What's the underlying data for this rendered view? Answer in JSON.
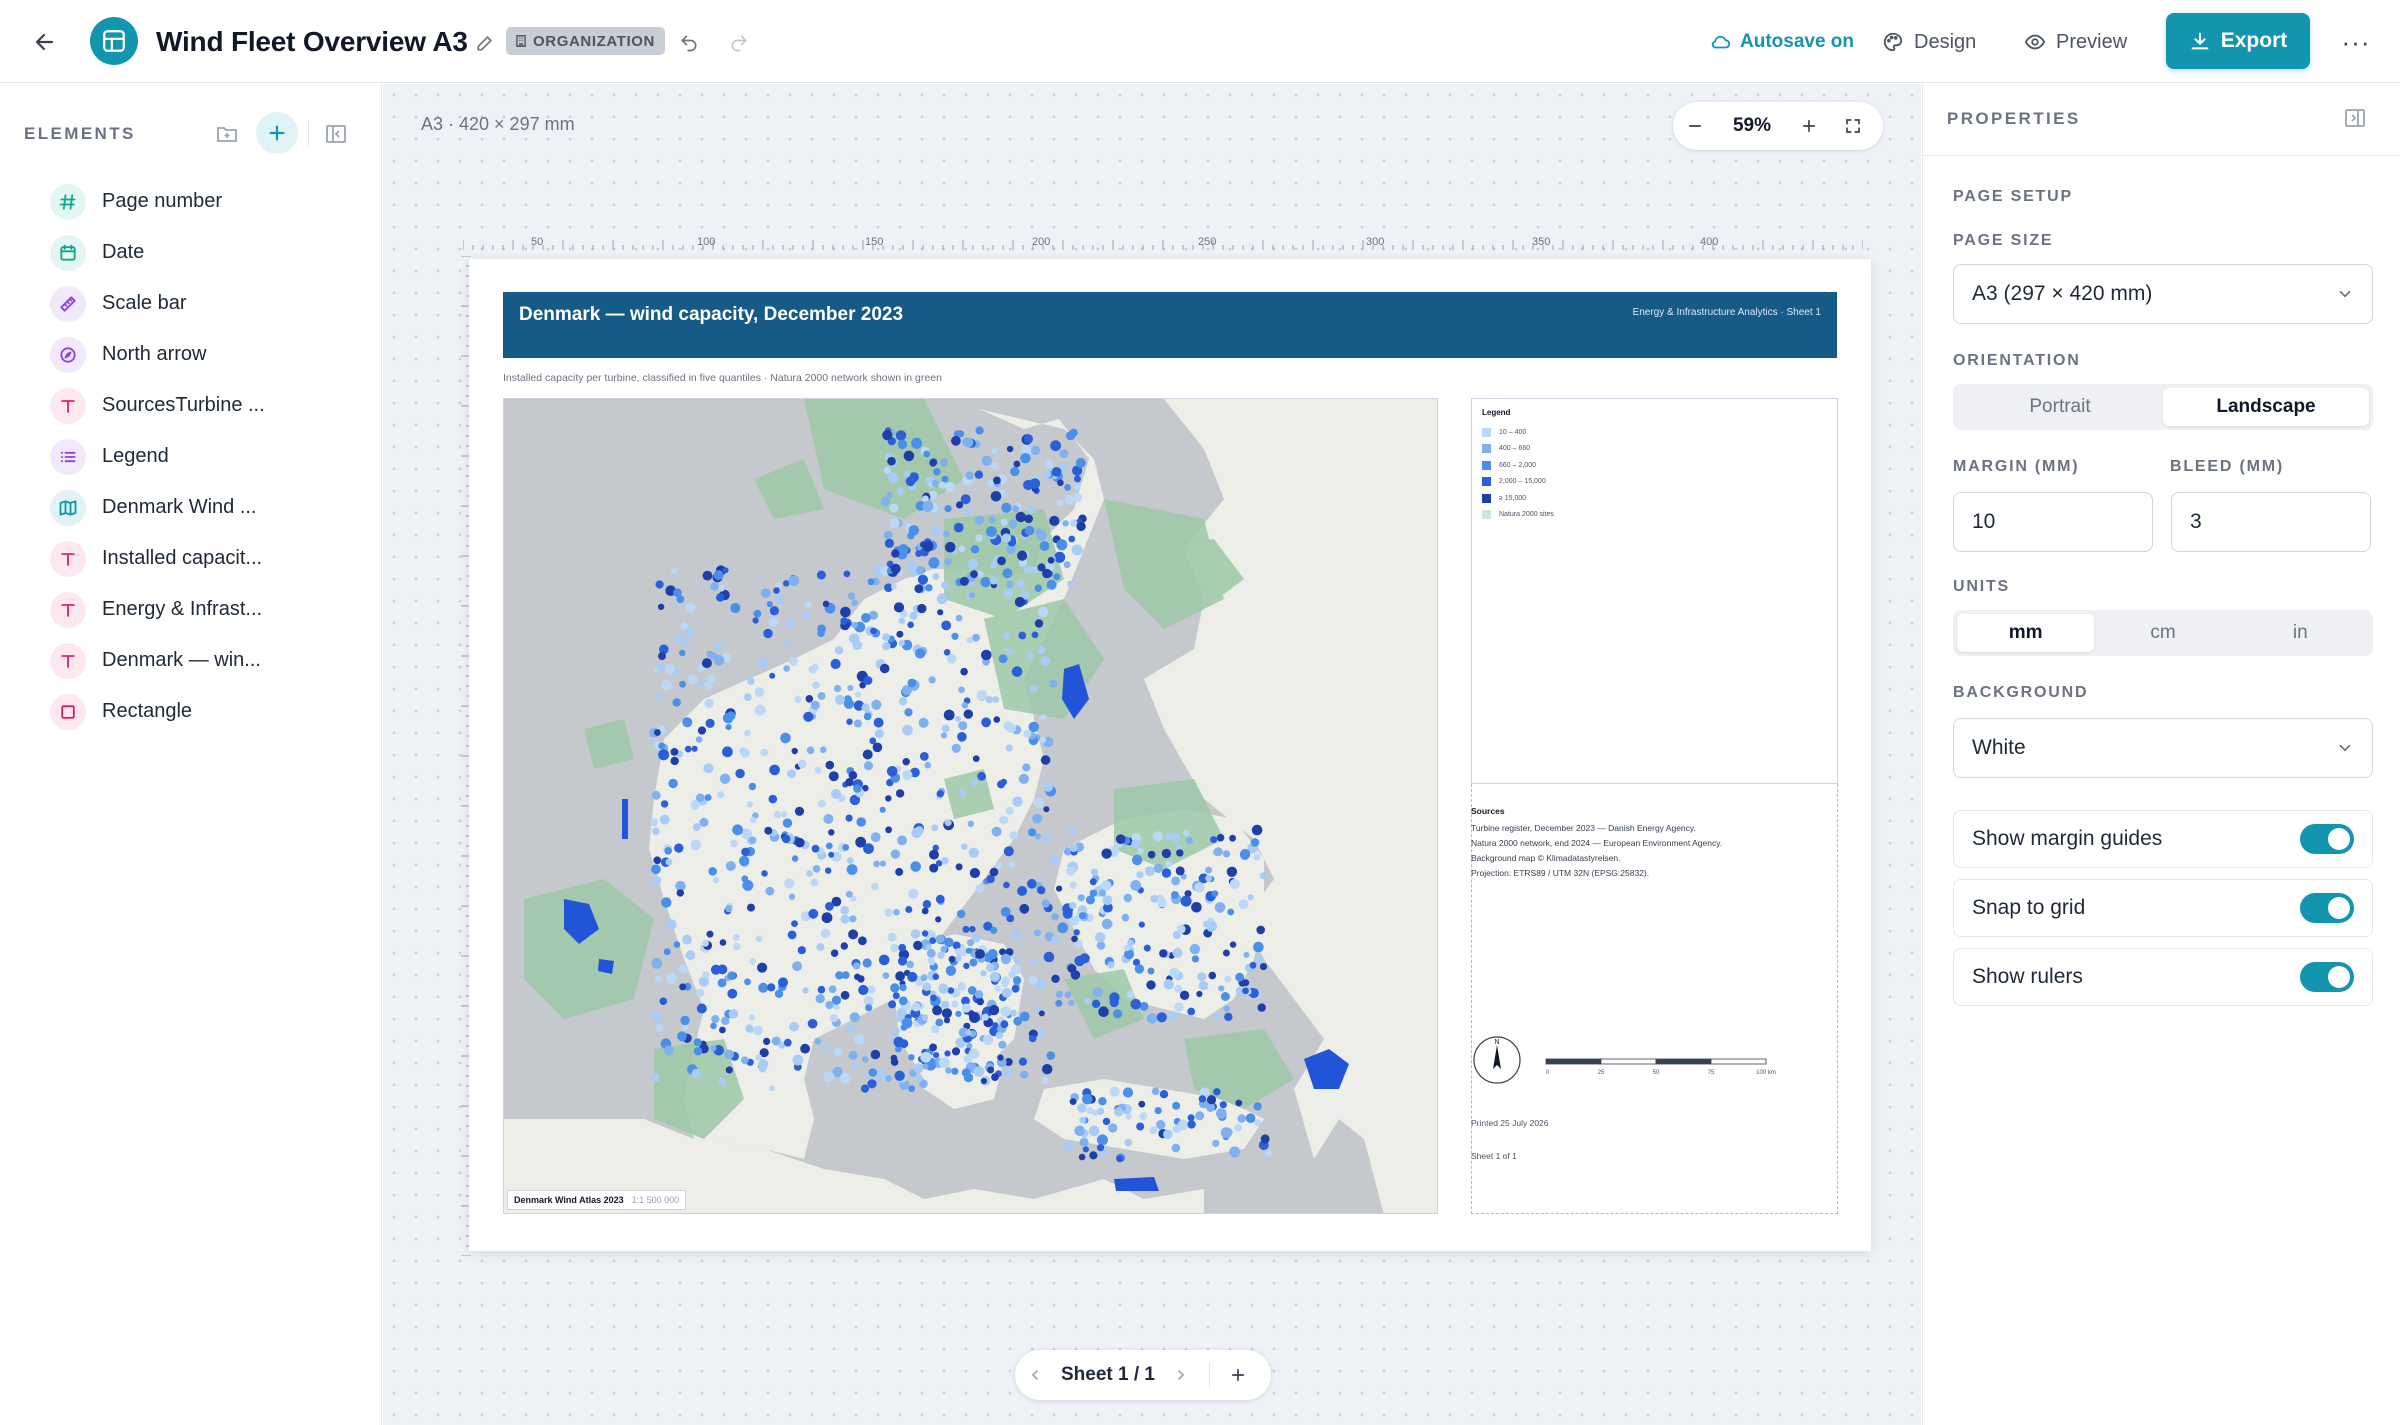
{
  "topbar": {
    "title": "Wind Fleet Overview A3",
    "badge": "ORGANIZATION",
    "autosave": "Autosave on",
    "design": "Design",
    "preview": "Preview",
    "export": "Export",
    "more": "···"
  },
  "elements_panel": {
    "title": "ELEMENTS",
    "items": [
      {
        "label": "Page number",
        "icon": "hash-icon",
        "color": "#12a58a",
        "bg": "#e3f6f1"
      },
      {
        "label": "Date",
        "icon": "calendar-icon",
        "color": "#12a58a",
        "bg": "#e3f6f1"
      },
      {
        "label": "Scale bar",
        "icon": "ruler-icon",
        "color": "#8b45d6",
        "bg": "#f1e8fb"
      },
      {
        "label": "North arrow",
        "icon": "compass-icon",
        "color": "#8b45d6",
        "bg": "#f1e8fb"
      },
      {
        "label": "SourcesTurbine ...",
        "icon": "text-icon",
        "color": "#e0245e",
        "bg": "#fde8ef"
      },
      {
        "label": "Legend",
        "icon": "list-icon",
        "color": "#8b45d6",
        "bg": "#f1e8fb"
      },
      {
        "label": "Denmark Wind ...",
        "icon": "map-icon",
        "color": "#1395b0",
        "bg": "#e1f3f7"
      },
      {
        "label": "Installed capacit...",
        "icon": "text-icon",
        "color": "#e0245e",
        "bg": "#fde8ef"
      },
      {
        "label": "Energy & Infrast...",
        "icon": "text-icon",
        "color": "#e0245e",
        "bg": "#fde8ef"
      },
      {
        "label": "Denmark — win...",
        "icon": "text-icon",
        "color": "#e0245e",
        "bg": "#fde8ef"
      },
      {
        "label": "Rectangle",
        "icon": "square-icon",
        "color": "#e0245e",
        "bg": "#fde8ef"
      }
    ]
  },
  "canvas": {
    "page_info": "A3 · 420 × 297 mm",
    "zoom": "59%",
    "ruler_labels": [
      "50",
      "100",
      "150",
      "200",
      "250",
      "300",
      "350",
      "400"
    ],
    "sheet_label": "Sheet 1 / 1"
  },
  "layout_page": {
    "title": "Denmark — wind capacity, December 2023",
    "org": "Energy & Infrastructure Analytics · Sheet 1",
    "subtitle": "Installed capacity per turbine, classified in five quantiles · Natura 2000 network shown in green",
    "map_label": "Denmark Wind Atlas 2023",
    "map_scale": "1:1 500 000",
    "legend_title": "Legend",
    "legend": [
      {
        "label": "10 – 400",
        "color": "#bcd8f7"
      },
      {
        "label": "400 – 660",
        "color": "#7fb0f0"
      },
      {
        "label": "660 – 2,000",
        "color": "#4a8fe8"
      },
      {
        "label": "2,000 – 15,000",
        "color": "#2a5fd8"
      },
      {
        "label": "≥ 15,000",
        "color": "#1f3fa8"
      },
      {
        "label": "Natura 2000 sites",
        "color": "#cfe8d6"
      }
    ],
    "sources_title": "Sources",
    "sources": [
      "Turbine register, December 2023 — Danish Energy Agency.",
      "Natura 2000 network, end 2024 — European Environment Agency.",
      "Background map © Klimadatastyrelsen.",
      "Projection: ETRS89 / UTM 32N (EPSG:25832)."
    ],
    "north_label": "N",
    "scale_ticks": [
      "0",
      "25",
      "50",
      "75",
      "100 km"
    ],
    "printed": "Printed 25 July 2026",
    "sheet": "Sheet 1 of 1"
  },
  "properties": {
    "title": "PROPERTIES",
    "section": "PAGE SETUP",
    "page_size_label": "PAGE SIZE",
    "page_size_value": "A3 (297 × 420 mm)",
    "orientation_label": "ORIENTATION",
    "orientation_options": [
      "Portrait",
      "Landscape"
    ],
    "orientation_selected": "Landscape",
    "margin_label": "MARGIN (MM)",
    "margin_value": "10",
    "bleed_label": "BLEED (MM)",
    "bleed_value": "3",
    "units_label": "UNITS",
    "units_options": [
      "mm",
      "cm",
      "in"
    ],
    "units_selected": "mm",
    "background_label": "BACKGROUND",
    "background_value": "White",
    "toggles": [
      {
        "label": "Show margin guides",
        "on": true
      },
      {
        "label": "Snap to grid",
        "on": true
      },
      {
        "label": "Show rulers",
        "on": true
      }
    ]
  }
}
